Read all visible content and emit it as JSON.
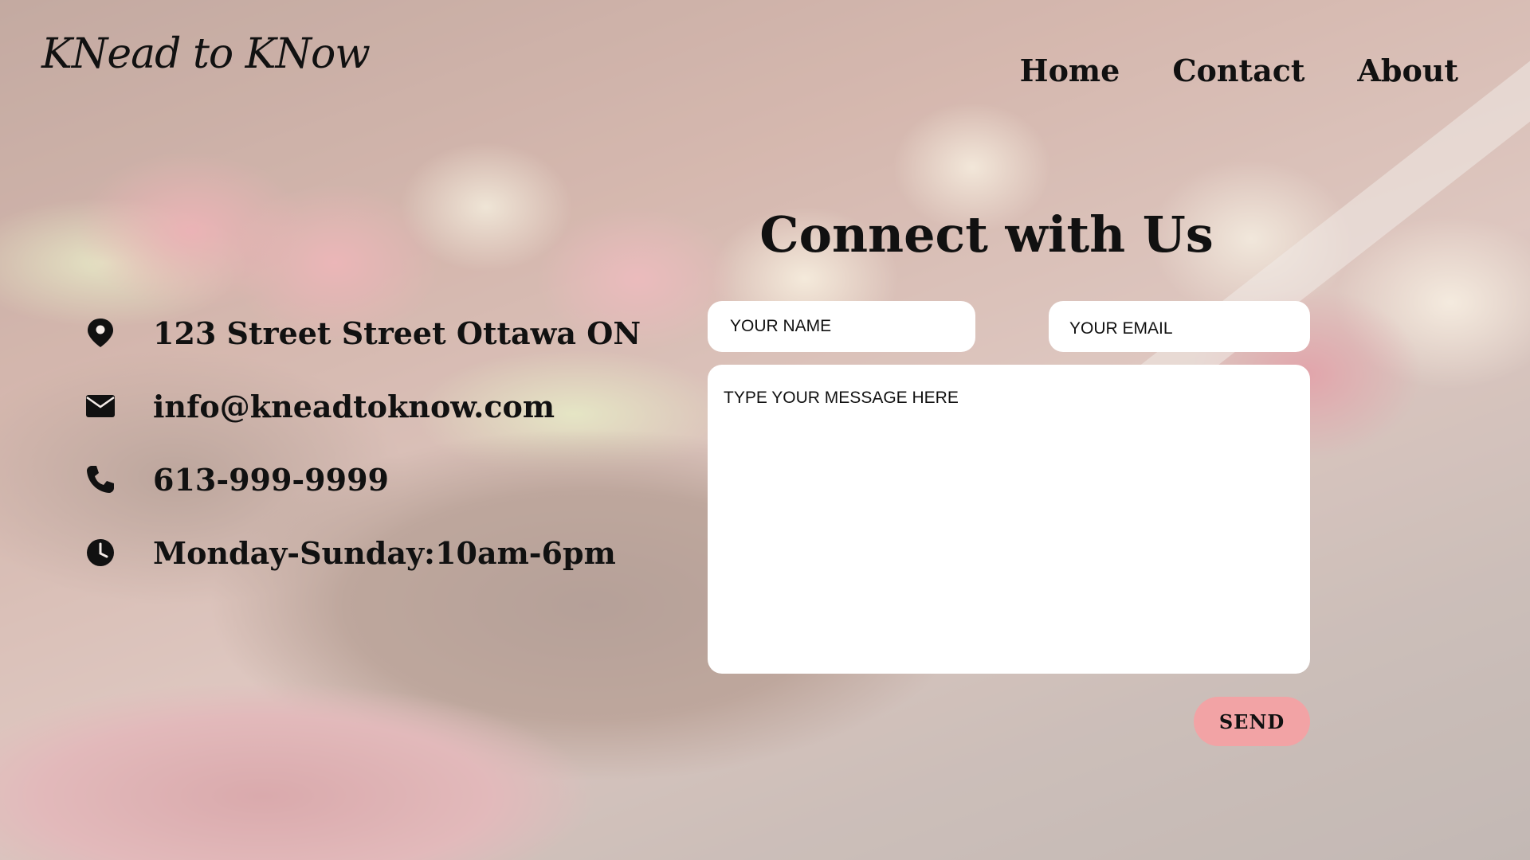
{
  "brand": {
    "logo_text": "KNead to KNow"
  },
  "nav": {
    "items": [
      {
        "label": "Home"
      },
      {
        "label": "Contact"
      },
      {
        "label": "About"
      }
    ]
  },
  "contact_form": {
    "heading": "Connect with Us",
    "name_placeholder": "YOUR NAME",
    "email_placeholder": "YOUR EMAIL",
    "message_placeholder": "TYPE YOUR MESSAGE HERE",
    "send_label": "SEND",
    "send_color": "#f2a3a5"
  },
  "contact_info": [
    {
      "icon": "location-pin-icon",
      "text": "123 Street Street Ottawa ON"
    },
    {
      "icon": "envelope-icon",
      "text": "info@kneadtoknow.com"
    },
    {
      "icon": "phone-icon",
      "text": "613-999-9999"
    },
    {
      "icon": "clock-icon",
      "text": "Monday-Sunday:10am-6pm"
    }
  ]
}
